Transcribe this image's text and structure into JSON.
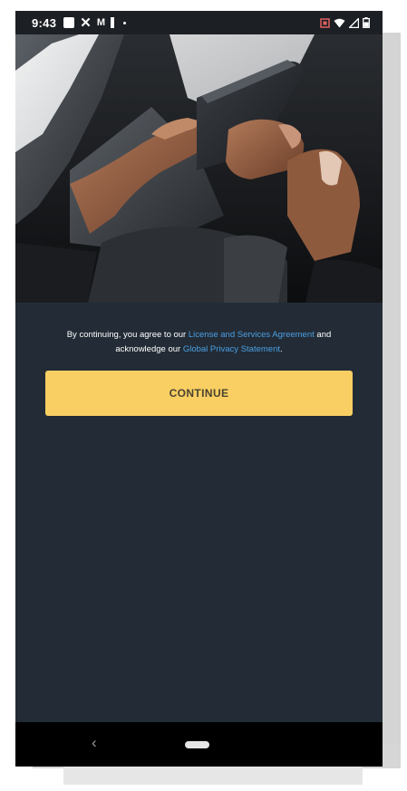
{
  "status_bar": {
    "time": "9:43",
    "left_icons": [
      "square-notification-icon",
      "x-icon",
      "gmail-icon",
      "battery-saver-icon",
      "dot-icon"
    ],
    "right_icons": [
      "vibrate-icon",
      "wifi-icon",
      "signal-icon",
      "battery-icon"
    ]
  },
  "hero": {
    "description_icon": "hands-holding-phone-photo"
  },
  "agreement": {
    "prefix": "By continuing, you agree to our ",
    "link1": "License and Services Agreement",
    "middle": " and acknowledge our ",
    "link2": "Global Privacy Statement",
    "suffix": "."
  },
  "continue_button": {
    "label": "CONTINUE"
  },
  "nav_bar": {
    "back_icon": "‹"
  },
  "colors": {
    "background": "#232c36",
    "accent": "#f9cf63",
    "link": "#4a9fe3",
    "status_bar": "#1c1f24"
  }
}
